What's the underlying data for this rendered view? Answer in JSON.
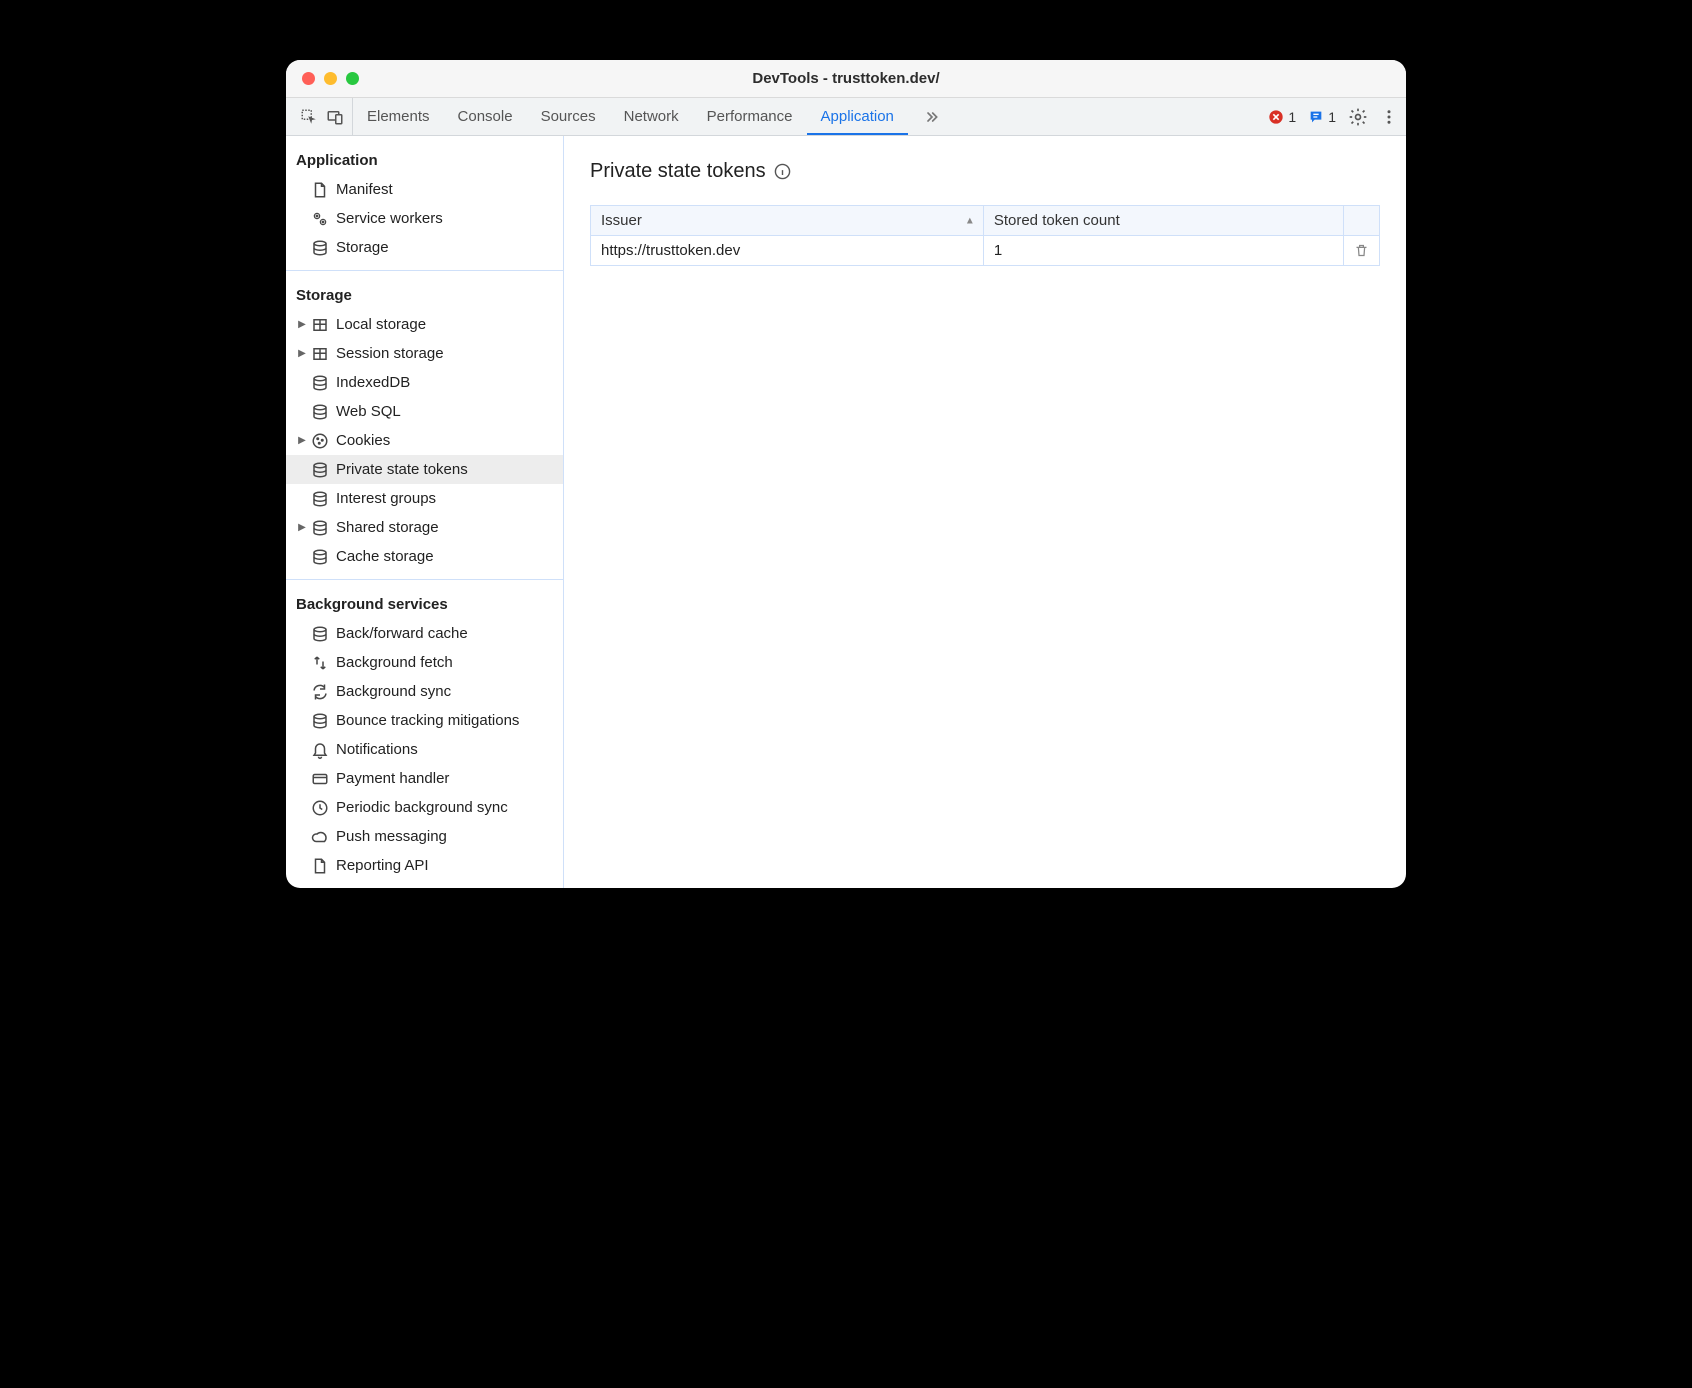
{
  "window_title": "DevTools - trusttoken.dev/",
  "tabs": {
    "elements": "Elements",
    "console": "Console",
    "sources": "Sources",
    "network": "Network",
    "performance": "Performance",
    "application": "Application"
  },
  "status": {
    "errors": "1",
    "messages": "1"
  },
  "sidebar": {
    "application": {
      "heading": "Application",
      "items": {
        "manifest": "Manifest",
        "service_workers": "Service workers",
        "storage": "Storage"
      }
    },
    "storage": {
      "heading": "Storage",
      "items": {
        "local_storage": "Local storage",
        "session_storage": "Session storage",
        "indexeddb": "IndexedDB",
        "web_sql": "Web SQL",
        "cookies": "Cookies",
        "private_state_tokens": "Private state tokens",
        "interest_groups": "Interest groups",
        "shared_storage": "Shared storage",
        "cache_storage": "Cache storage"
      }
    },
    "background_services": {
      "heading": "Background services",
      "items": {
        "back_forward_cache": "Back/forward cache",
        "background_fetch": "Background fetch",
        "background_sync": "Background sync",
        "bounce_tracking": "Bounce tracking mitigations",
        "notifications": "Notifications",
        "payment_handler": "Payment handler",
        "periodic_background_sync": "Periodic background sync",
        "push_messaging": "Push messaging",
        "reporting_api": "Reporting API"
      }
    }
  },
  "main": {
    "heading": "Private state tokens",
    "columns": {
      "issuer": "Issuer",
      "stored_token_count": "Stored token count"
    },
    "rows": [
      {
        "issuer": "https://trusttoken.dev",
        "count": "1"
      }
    ]
  }
}
